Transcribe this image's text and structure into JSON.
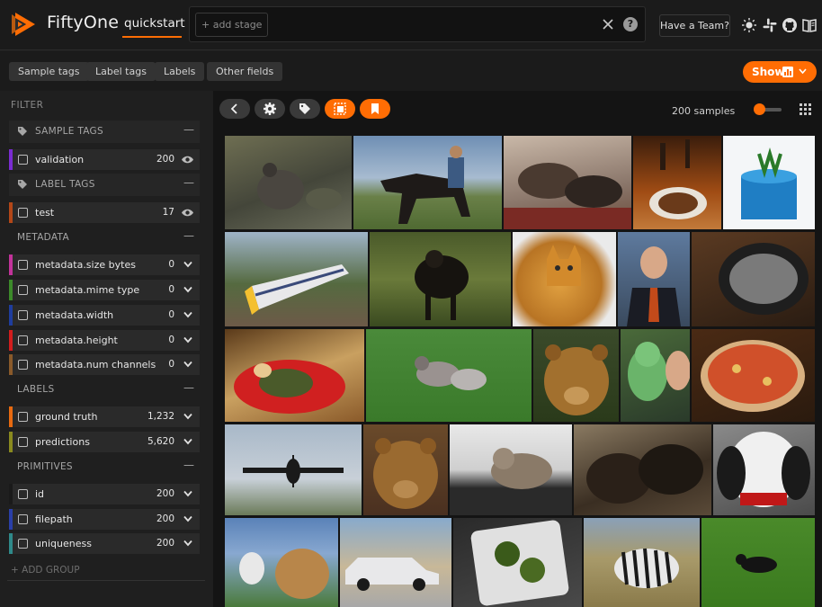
{
  "header": {
    "brand": "FiftyOne",
    "dataset": "quickstart",
    "add_stage": "+ add stage",
    "help": "?",
    "team_button": "Have a Team?",
    "accent_color": "#ff6d04",
    "icons": [
      "theme-sun-icon",
      "slack-icon",
      "github-icon",
      "docs-book-icon"
    ]
  },
  "filter_bar": {
    "pills": [
      "Sample tags",
      "Label tags",
      "Labels",
      "Other fields"
    ],
    "show_button": "Show"
  },
  "sidebar": {
    "filter_heading": "FILTER",
    "groups": [
      {
        "title": "SAMPLE TAGS",
        "collapse": "—",
        "rows": [
          {
            "label": "validation",
            "count": "200",
            "color": "#7a2cd1"
          }
        ]
      },
      {
        "title": "LABEL TAGS",
        "collapse": "—",
        "rows": [
          {
            "label": "test",
            "count": "17",
            "color": "#b34718"
          }
        ]
      }
    ],
    "sections": [
      {
        "title": "METADATA",
        "collapse": "—",
        "rows": [
          {
            "label": "metadata.size bytes",
            "count": "0",
            "color": "#c2339a"
          },
          {
            "label": "metadata.mime type",
            "count": "0",
            "color": "#3c8a2a"
          },
          {
            "label": "metadata.width",
            "count": "0",
            "color": "#1f3d9e"
          },
          {
            "label": "metadata.height",
            "count": "0",
            "color": "#d21d1d"
          },
          {
            "label": "metadata.num channels",
            "count": "0",
            "color": "#8a5a2a"
          }
        ]
      },
      {
        "title": "LABELS",
        "collapse": "—",
        "rows": [
          {
            "label": "ground truth",
            "count": "1,232",
            "color": "#e86a10"
          },
          {
            "label": "predictions",
            "count": "5,620",
            "color": "#8a8a1f"
          }
        ]
      },
      {
        "title": "PRIMITIVES",
        "collapse": "—",
        "rows": [
          {
            "label": "id",
            "count": "200",
            "color": "#1a1a1a"
          },
          {
            "label": "filepath",
            "count": "200",
            "color": "#2a3fa8"
          },
          {
            "label": "uniqueness",
            "count": "200",
            "color": "#2f8a8a"
          }
        ]
      }
    ],
    "add_group": "+ ADD GROUP"
  },
  "grid": {
    "sample_count": "200 samples",
    "zoom_level": 0.1
  }
}
